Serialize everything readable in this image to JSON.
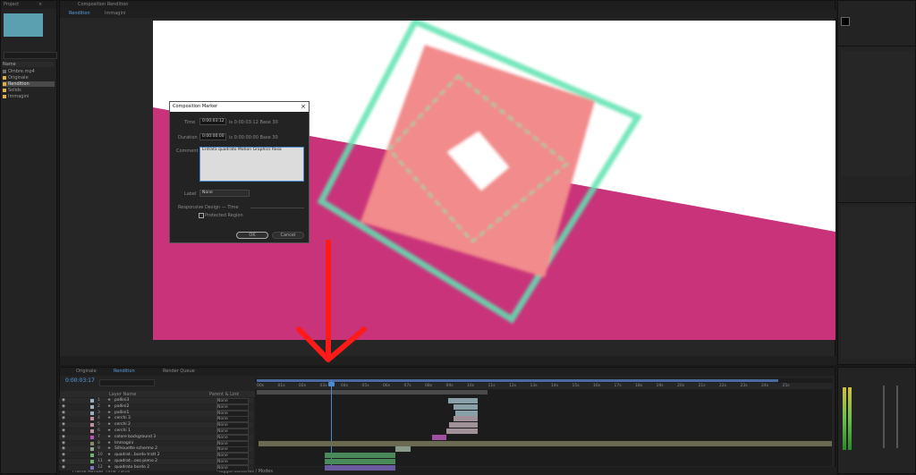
{
  "project": {
    "tab_label": "Project",
    "items": [
      {
        "name": "Ombre.mp4",
        "color": "#6a6a6a"
      },
      {
        "name": "Originale",
        "color": "#e0b040"
      },
      {
        "name": "Rendition",
        "color": "#e0b040"
      },
      {
        "name": "Solids",
        "color": "#e0b040"
      },
      {
        "name": "Immagini",
        "color": "#e0b040"
      }
    ],
    "col_name": "Name",
    "search_placeholder": ""
  },
  "comp_tabs": [
    "Rendition",
    "Immagini"
  ],
  "comp_header": "Composition Rendition",
  "dialog": {
    "title": "Composition Marker",
    "time_label": "Time",
    "time_value": "0:00:03:12",
    "time_info": "is 0:00:03:12  Base 30",
    "duration_label": "Duration",
    "duration_value": "0:00:00:00",
    "duration_info": "is 0:00:00:00  Base 30",
    "comment_label": "Comment",
    "comment_value": "Entrata quadrato Motion Graphics Rosa",
    "label_label": "Label",
    "label_value": "None",
    "section": "Responsive Design — Time",
    "protected_label": "Protected Region",
    "ok": "OK",
    "cancel": "Cancel"
  },
  "timeline": {
    "tabs": [
      "Originale",
      "Rendition",
      "Render Queue"
    ],
    "timecode": "0:00:03:17",
    "col_layer": "Layer Name",
    "col_parent": "Parent & Link",
    "ruler": [
      "00s",
      "01s",
      "02s",
      "03s",
      "04s",
      "05s",
      "06s",
      "07s",
      "08s",
      "09s",
      "10s",
      "11s",
      "12s",
      "13s",
      "14s",
      "15s",
      "16s",
      "17s",
      "18s",
      "19s",
      "20s",
      "21s",
      "22s",
      "23s",
      "24s",
      "25s"
    ],
    "layers": [
      {
        "num": "1",
        "name": "pallini3",
        "parent": "None",
        "color": "#9ab0c0"
      },
      {
        "num": "2",
        "name": "pallini2",
        "parent": "None",
        "color": "#9ab0c0"
      },
      {
        "num": "3",
        "name": "pallini1",
        "parent": "None",
        "color": "#9ab0c0"
      },
      {
        "num": "4",
        "name": "cerchi 3",
        "parent": "None",
        "color": "#c090a0"
      },
      {
        "num": "5",
        "name": "cerchi 2",
        "parent": "None",
        "color": "#c090a0"
      },
      {
        "num": "6",
        "name": "cerchi 1",
        "parent": "None",
        "color": "#c090a0"
      },
      {
        "num": "7",
        "name": "colore background 3",
        "parent": "None",
        "color": "#c050c0"
      },
      {
        "num": "8",
        "name": "Immagini",
        "parent": "None",
        "color": "#8a8a6a"
      },
      {
        "num": "9",
        "name": "Silhouette schermo 2",
        "parent": "None",
        "color": "#90a890"
      },
      {
        "num": "10",
        "name": "quadrat...bordo tratt 2",
        "parent": "None",
        "color": "#70b070"
      },
      {
        "num": "11",
        "name": "quadrat...oso pieno 2",
        "parent": "None",
        "color": "#70b070"
      },
      {
        "num": "12",
        "name": "quadrato bordo 2",
        "parent": "None",
        "color": "#8070c0"
      }
    ],
    "footer": "Frame Render Time  79ms",
    "toggle": "Toggle Switches / Modes"
  },
  "colors": {
    "pink": "#c9337a",
    "salmon": "#f28b8b",
    "mint": "#5fe3b0",
    "arrow": "#ff1a1a"
  }
}
